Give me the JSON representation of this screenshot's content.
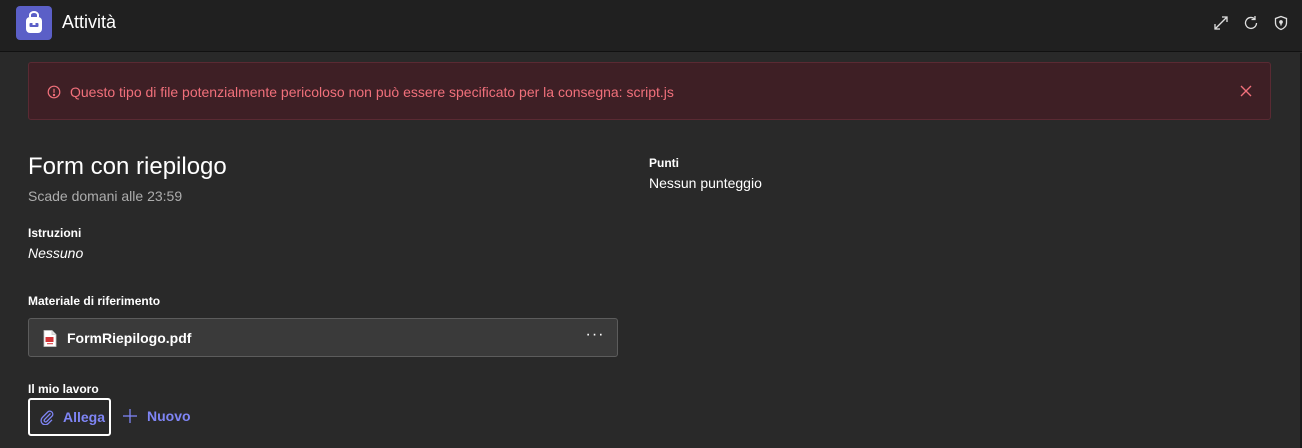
{
  "header": {
    "title": "Attività",
    "icons": [
      "backpack-icon",
      "expand-icon",
      "refresh-icon",
      "shield-icon"
    ]
  },
  "banner": {
    "message": "Questo tipo di file potenzialmente pericoloso non può essere specificato per la consegna: script.js",
    "color": "#f1707b",
    "background": "#3e1f25"
  },
  "assignment": {
    "title": "Form con riepilogo",
    "due": "Scade domani alle 23:59",
    "instructions_label": "Istruzioni",
    "instructions_value": "Nessuno",
    "reference_label": "Materiale di riferimento",
    "reference_file": "FormRiepilogo.pdf",
    "more_label": "···",
    "points_label": "Punti",
    "points_value": "Nessun punteggio",
    "my_work_label": "Il mio lavoro",
    "attach_label": "Allega",
    "new_label": "Nuovo"
  },
  "colors": {
    "accent": "#7f85f5",
    "brand": "#5b5fc7",
    "error": "#f1707b"
  }
}
